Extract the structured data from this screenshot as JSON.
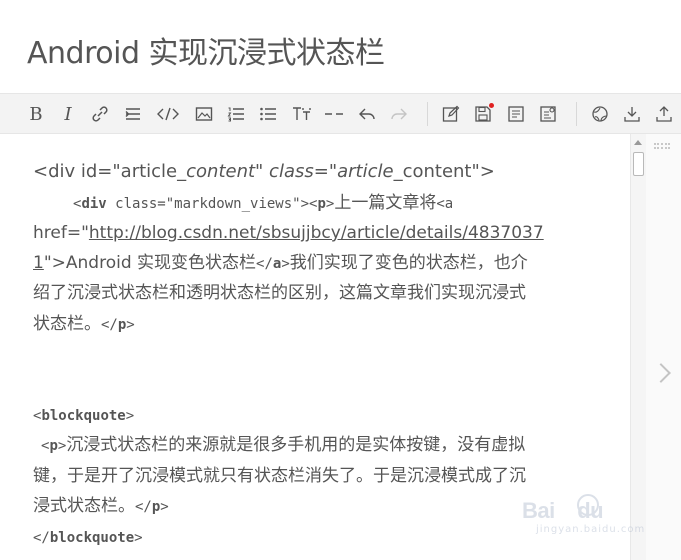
{
  "page": {
    "title": "Android 实现沉浸式状态栏"
  },
  "toolbar": {
    "buttons": [
      {
        "name": "bold-button",
        "glyph": "B"
      },
      {
        "name": "italic-button",
        "glyph": "I"
      }
    ]
  },
  "editor": {
    "lines": [
      {
        "parts": [
          "<div id=\"article",
          "_content\" class=\"article",
          "_content\">"
        ]
      },
      {
        "parts": [
          "<",
          "div",
          " class=\"markdown_views\"><",
          "p",
          ">",
          "上一篇文章将",
          "<a"
        ]
      },
      {
        "parts": [
          "href=\"",
          "http://blog.csdn.net/sbsujjbcy/article/details/4837037"
        ]
      },
      {
        "parts": [
          "1",
          "\">Android 实现变色状态栏",
          "</",
          "a",
          ">",
          "我们实现了变色的状态栏，也介"
        ]
      },
      {
        "parts": [
          "绍了沉浸式状态栏和透明状态栏的区别，这篇文章我们实现沉浸式"
        ]
      },
      {
        "parts": [
          "状态栏。",
          "</",
          "p",
          ">"
        ]
      },
      {
        "parts": [
          "<",
          "blockquote",
          ">"
        ]
      },
      {
        "parts": [
          "<",
          "p",
          ">",
          "沉浸式状态栏的来源就是很多手机用的是实体按键，没有虚拟"
        ]
      },
      {
        "parts": [
          "键，于是开了沉浸模式就只有状态栏消失了。于是沉浸模式成了沉"
        ]
      },
      {
        "parts": [
          "浸式状态栏。",
          "</",
          "p",
          ">"
        ]
      },
      {
        "parts": [
          "</",
          "blockquote",
          ">"
        ]
      }
    ]
  },
  "watermark": {
    "text": "Bai",
    "suffix": "du",
    "sub": "jingyan.baidu.com"
  }
}
